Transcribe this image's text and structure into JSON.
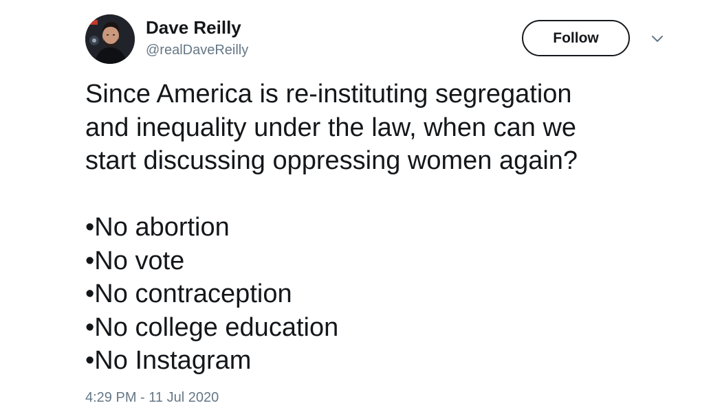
{
  "tweet": {
    "author": {
      "display_name": "Dave Reilly",
      "handle": "@realDaveReilly"
    },
    "follow_label": "Follow",
    "text_lines": [
      "Since America is re-instituting segregation",
      "and inequality under the law, when can we",
      "start discussing oppressing women again?"
    ],
    "bullets": [
      "•No abortion",
      "•No vote",
      "•No contraception",
      "•No college education",
      "•No Instagram"
    ],
    "timestamp": "4:29 PM - 11 Jul 2020"
  },
  "colors": {
    "text": "#14171a",
    "secondary_text": "#657786",
    "background": "#ffffff"
  },
  "icons": {
    "avatar": "profile-photo",
    "menu": "chevron-down-icon"
  }
}
